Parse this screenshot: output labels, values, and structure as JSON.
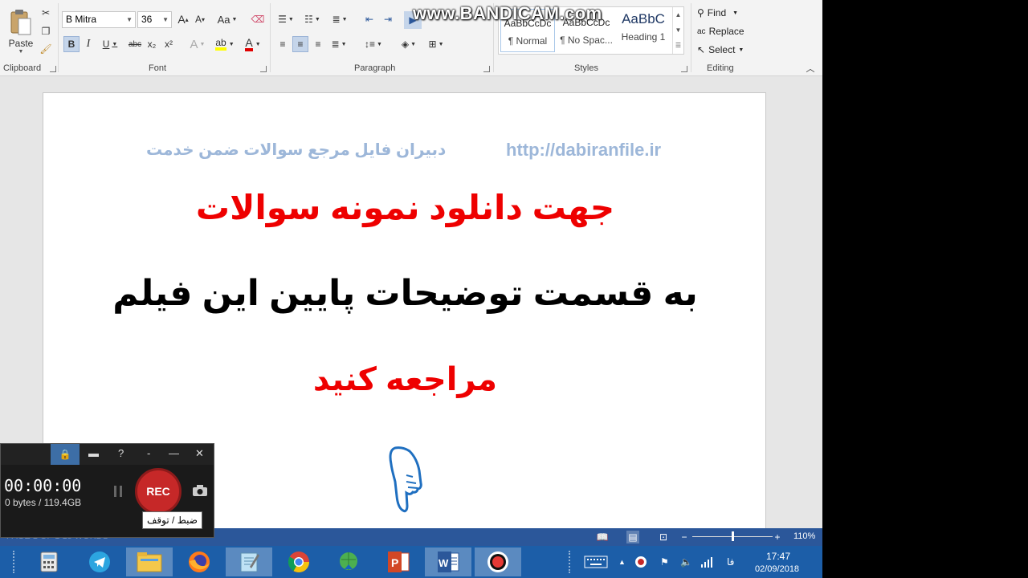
{
  "ribbon": {
    "clipboard": {
      "paste_label": "Paste",
      "group_label": "Clipboard"
    },
    "font": {
      "font_name": "B Mitra",
      "font_size": "36",
      "group_label": "Font",
      "grow_label": "A",
      "shrink_label": "A",
      "case_label": "Aa",
      "bold_label": "B",
      "italic_label": "I",
      "underline_label": "U",
      "strike_label": "abc",
      "sub_label": "x₂",
      "sup_label": "x²"
    },
    "paragraph": {
      "group_label": "Paragraph"
    },
    "styles": {
      "group_label": "Styles",
      "items": [
        {
          "preview": "AaBbCcDc",
          "name": "¶ Normal"
        },
        {
          "preview": "AaBbCcDc",
          "name": "¶ No Spac..."
        },
        {
          "preview": "AaBbC",
          "name": "Heading 1"
        }
      ]
    },
    "editing": {
      "group_label": "Editing",
      "find_label": "Find",
      "replace_label": "Replace",
      "select_label": "Select"
    }
  },
  "watermark": "www.BANDICAM.com",
  "document": {
    "header_url": "http://dabiranfile.ir",
    "header_text": "دبیران فایل مرجع سوالات ضمن خدمت",
    "line1": "جهت دانلود نمونه سوالات",
    "line2": "به قسمت توضیحات پایین این فیلم",
    "line3": "مراجعه کنید"
  },
  "statusbar": {
    "left_text": "PAGE 1 OF 1     15 WORDS",
    "zoom": "110%"
  },
  "bandicam": {
    "timer": "00:00:00",
    "bytes": "0 bytes / 119.4GB",
    "rec_label": "REC",
    "help_label": "?",
    "tooltip": "ضبط / توقف"
  },
  "taskbar": {
    "time": "17:47",
    "date": "02/09/2018",
    "lang": "فا"
  },
  "colors": {
    "accent": "#2b579a",
    "red_text": "#ee0000",
    "header_text": "#9db7d9",
    "taskbar": "#1c5ea8"
  }
}
